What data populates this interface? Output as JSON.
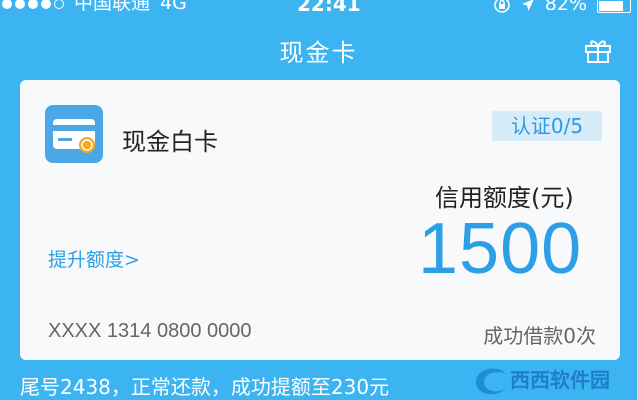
{
  "status_bar": {
    "carrier": "中国联通",
    "network": "4G",
    "time": "22:41",
    "battery": "82%"
  },
  "nav": {
    "title": "现金卡",
    "gift_icon": "gift-icon"
  },
  "card": {
    "name": "现金白卡",
    "verify_badge": "认证0/5",
    "credit_label": "信用额度(元)",
    "credit_amount": "1500",
    "raise_link": "提升额度>",
    "card_number": "XXXX 1314 0800 0000",
    "borrow_count": "成功借款0次"
  },
  "bottom_text": "尾号2438，正常还款，成功提额至230元",
  "watermark": "西西软件园",
  "colors": {
    "background": "#3cb4f2",
    "accent": "#2d9fe6",
    "card_bg": "#f7f9fb"
  }
}
